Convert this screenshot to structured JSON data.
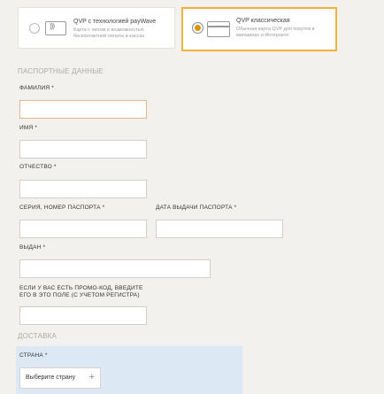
{
  "payment_options": [
    {
      "title": "QVP с технологией payWave",
      "description": "Карта с чипом и возможностью бесконтактной оплаты в кассах",
      "selected": false,
      "icon": "contactless-card-icon"
    },
    {
      "title": "QVP классическая",
      "description": "Обычная карта QVP для покупок в магазинах и Интернете",
      "selected": true,
      "icon": "card-icon"
    }
  ],
  "passport": {
    "section_title": "ПАСПОРТНЫЕ ДАННЫЕ",
    "surname_label": "ФАМИЛИЯ *",
    "name_label": "ИМЯ *",
    "patronymic_label": "ОТЧЕСТВО *",
    "series_label": "СЕРИЯ, НОМЕР ПАСПОРТА *",
    "issue_date_label": "ДАТА ВЫДАЧИ ПАСПОРТА *",
    "issued_by_label": "ВЫДАН *",
    "promo_label": "ЕСЛИ У ВАС ЕСТЬ ПРОМО-КОД, ВВЕДИТЕ ЕГО В ЭТО ПОЛЕ (С УЧЕТОМ РЕГИСТРА)"
  },
  "delivery": {
    "section_title": "ДОСТАВКА",
    "country_label": "СТРАНА *",
    "country_value": "Выберите страну",
    "plus_symbol": "+"
  },
  "colors": {
    "accent": "#f0b23a",
    "radio_fill": "#d9950e",
    "delivery_bg": "#dce8f4",
    "page_bg": "#f3f1ee"
  }
}
